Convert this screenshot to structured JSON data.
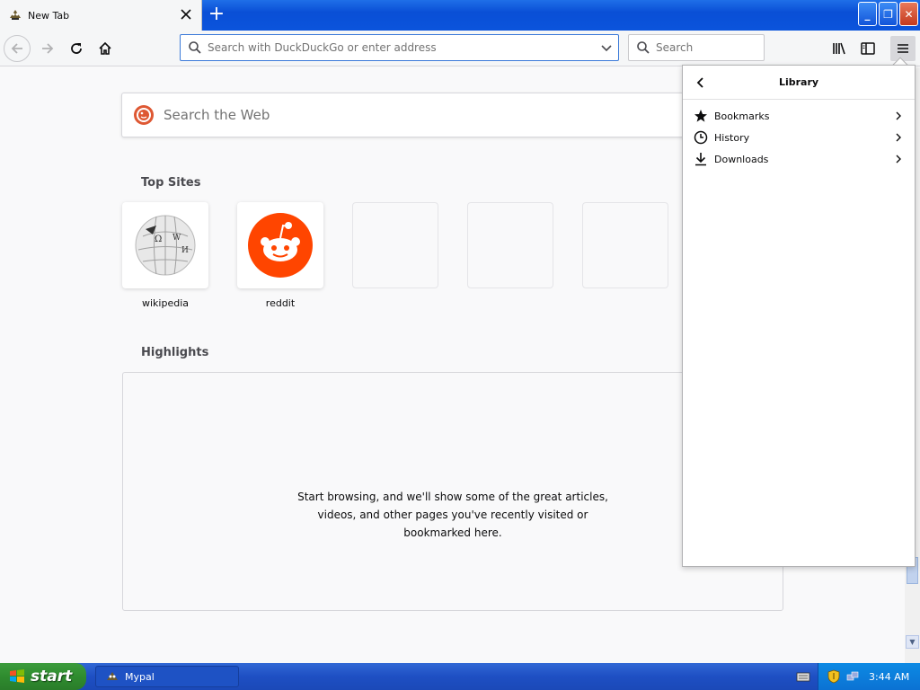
{
  "window": {
    "tab_title": "New Tab",
    "new_tab_symbol": "+",
    "minimize_symbol": "_",
    "restore_symbol": "❐",
    "close_symbol": "✕"
  },
  "toolbar": {
    "url_placeholder": "Search with DuckDuckGo or enter address",
    "search_placeholder": "Search"
  },
  "newtab": {
    "web_search_placeholder": "Search the Web",
    "top_sites_title": "Top Sites",
    "top_sites": [
      {
        "label": "wikipedia"
      },
      {
        "label": "reddit"
      },
      {
        "label": ""
      },
      {
        "label": ""
      },
      {
        "label": ""
      }
    ],
    "highlights_title": "Highlights",
    "highlights_empty_text": "Start browsing, and we'll show some of the great articles, videos, and other pages you've recently visited or bookmarked here."
  },
  "library_panel": {
    "title": "Library",
    "items": [
      {
        "label": "Bookmarks",
        "icon": "star-icon"
      },
      {
        "label": "History",
        "icon": "clock-icon"
      },
      {
        "label": "Downloads",
        "icon": "download-icon"
      }
    ]
  },
  "taskbar": {
    "start_label": "start",
    "task_label": "Mypal",
    "clock": "3:44 AM"
  },
  "colors": {
    "accent": "#0a84ff",
    "reddit": "#ff4500",
    "ddg": "#de5833",
    "xp_blue": "#245edb",
    "xp_green": "#2f8c2f"
  }
}
